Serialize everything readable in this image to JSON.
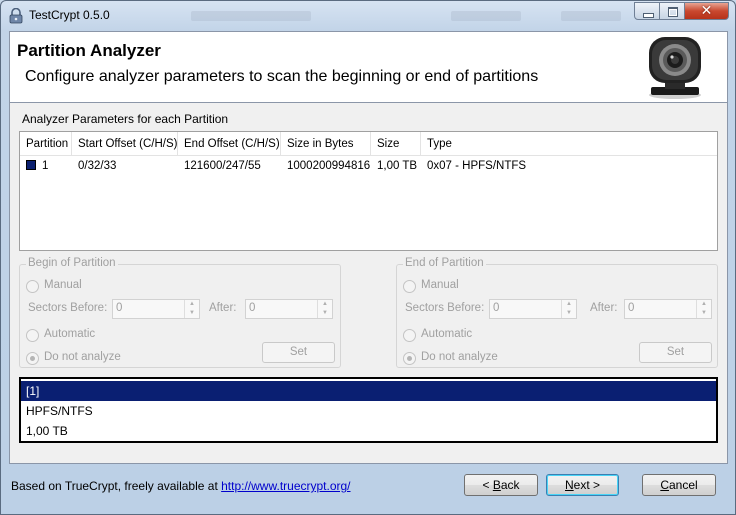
{
  "window": {
    "title": "TestCrypt 0.5.0"
  },
  "header": {
    "title": "Partition Analyzer",
    "subtitle": "Configure analyzer parameters to scan the beginning or end of partitions"
  },
  "analyzer": {
    "group_label": "Analyzer Parameters for each Partition",
    "columns": [
      "Partition",
      "Start Offset (C/H/S)",
      "End Offset (C/H/S)",
      "Size in Bytes",
      "Size",
      "Type"
    ],
    "rows": [
      {
        "partition": "1",
        "start": "0/32/33",
        "end": "121600/247/55",
        "bytes": "1000200994816",
        "size": "1,00 TB",
        "type": "0x07 - HPFS/NTFS",
        "color": "#0b1f6f"
      }
    ]
  },
  "begin": {
    "title": "Begin of Partition",
    "manual": "Manual",
    "sectors_before_label": "Sectors Before:",
    "sectors_before_value": "0",
    "after_label": "After:",
    "after_value": "0",
    "automatic": "Automatic",
    "do_not_analyze": "Do not analyze",
    "set": "Set"
  },
  "end": {
    "title": "End of Partition",
    "manual": "Manual",
    "sectors_before_label": "Sectors Before:",
    "sectors_before_value": "0",
    "after_label": "After:",
    "after_value": "0",
    "automatic": "Automatic",
    "do_not_analyze": "Do not analyze",
    "set": "Set"
  },
  "info": [
    "[1]",
    "HPFS/NTFS",
    "1,00 TB"
  ],
  "footer": {
    "text": "Based on TrueCrypt, freely available at ",
    "link": "http://www.truecrypt.org/"
  },
  "buttons": {
    "back_prefix": "< ",
    "back_key": "B",
    "back_rest": "ack",
    "next_key": "N",
    "next_rest": "ext >",
    "cancel_key": "C",
    "cancel_rest": "ancel"
  },
  "colors": {
    "selection": "#0a1f72",
    "close_button": "#c9482f"
  },
  "icons": [
    "app-lock-icon",
    "minimize-icon",
    "maximize-icon",
    "close-icon",
    "webcam-logo-icon"
  ]
}
